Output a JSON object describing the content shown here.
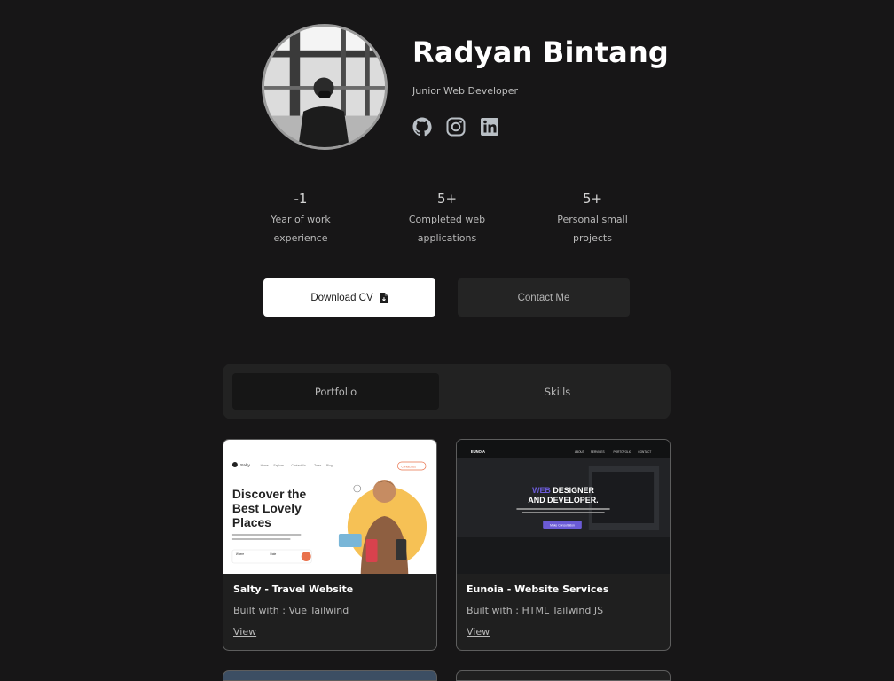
{
  "profile": {
    "name": "Radyan Bintang",
    "role": "Junior Web Developer",
    "socials": [
      {
        "icon": "github-icon",
        "label": "GitHub"
      },
      {
        "icon": "instagram-icon",
        "label": "Instagram"
      },
      {
        "icon": "linkedin-icon",
        "label": "LinkedIn"
      }
    ]
  },
  "stats": [
    {
      "value": "-1",
      "line1": "Year of work",
      "line2": "experience"
    },
    {
      "value": "5+",
      "line1": "Completed web",
      "line2": "applications"
    },
    {
      "value": "5+",
      "line1": "Personal small",
      "line2": "projects"
    }
  ],
  "actions": {
    "download_cv": "Download CV",
    "contact_me": "Contact Me"
  },
  "tabs": [
    {
      "label": "Portfolio",
      "active": true
    },
    {
      "label": "Skills",
      "active": false
    }
  ],
  "projects": [
    {
      "title": "Salty - Travel Website",
      "built_with": "Built with : Vue Tailwind",
      "view_label": "View",
      "preview": {
        "brand": "Salty",
        "nav": [
          "Home",
          "Explore",
          "Contact Us",
          "Tours",
          "Blog"
        ],
        "cta": "Contact Us",
        "headline": [
          "Discover the",
          "Best Lovely",
          "Places"
        ],
        "where": "Where",
        "date": "Date"
      }
    },
    {
      "title": "Eunoia - Website Services",
      "built_with": "Built with : HTML Tailwind JS",
      "view_label": "View",
      "preview": {
        "brand": "EUNOIA",
        "nav": [
          "ABOUT",
          "SERVICES",
          "PORTOFOLIO",
          "CONTACT"
        ],
        "headline_accent": "WEB",
        "headline_rest": " DESIGNER",
        "headline_line2": "AND DEVELOPER.",
        "cta": "Make Consultation"
      }
    }
  ],
  "colors": {
    "background": "#171617",
    "card": "#1f1f1f",
    "accent_purple": "#6b5bd6",
    "salty_orange": "#f6c155"
  }
}
